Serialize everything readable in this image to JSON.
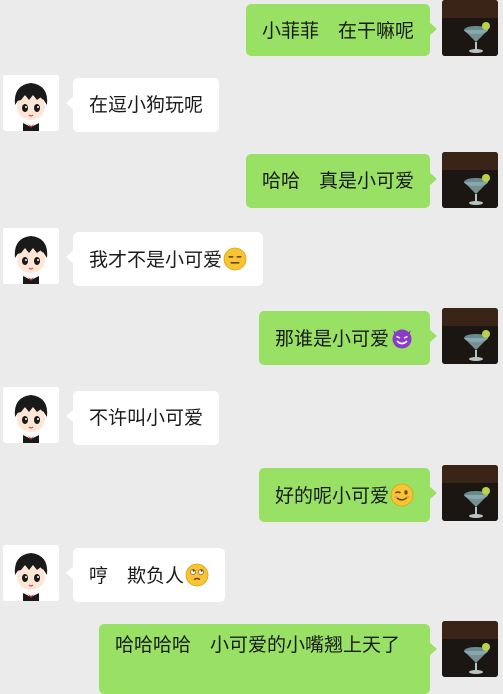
{
  "messages": [
    {
      "side": "out",
      "text": "小菲菲　在干嘛呢",
      "emoji": null
    },
    {
      "side": "in",
      "text": "在逗小狗玩呢",
      "emoji": null
    },
    {
      "side": "out",
      "text": "哈哈　真是小可爱",
      "emoji": null
    },
    {
      "side": "in",
      "text": "我才不是小可爱",
      "emoji": "expressionless-face-emoji"
    },
    {
      "side": "out",
      "text": "那谁是小可爱",
      "emoji": "smiling-devil-emoji"
    },
    {
      "side": "in",
      "text": "不许叫小可爱",
      "emoji": null
    },
    {
      "side": "out",
      "text": "好的呢小可爱",
      "emoji": "winking-face-emoji"
    },
    {
      "side": "in",
      "text": "哼　欺负人",
      "emoji": "face-with-rolling-eyes-emoji"
    },
    {
      "side": "out",
      "text": "哈哈哈哈　小可爱的小嘴翘上天了",
      "emoji": null
    }
  ],
  "colors": {
    "background": "#ebebeb",
    "incoming_bubble": "#ffffff",
    "outgoing_bubble": "#98e165"
  }
}
